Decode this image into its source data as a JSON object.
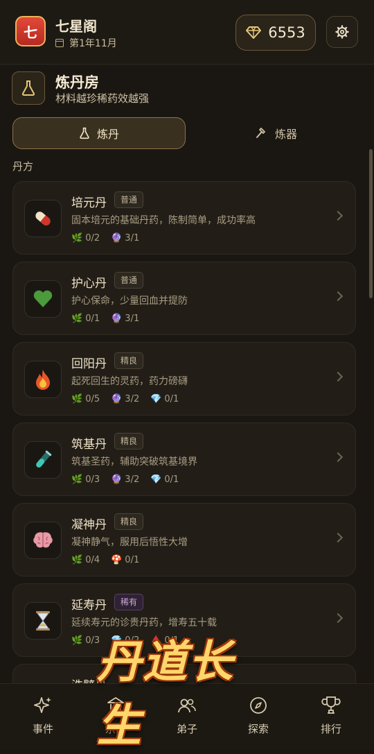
{
  "header": {
    "logo_char": "七",
    "sect_name": "七星阁",
    "date": "第1年11月",
    "gems": "6553"
  },
  "room": {
    "title": "炼丹房",
    "subtitle": "材料越珍稀药效越强"
  },
  "tabs": [
    {
      "label": "炼丹",
      "icon": "flask-icon",
      "active": true
    },
    {
      "label": "炼器",
      "icon": "hammer-icon",
      "active": false
    }
  ],
  "section_label": "丹方",
  "recipes": [
    {
      "name": "培元丹",
      "badge": "普通",
      "icon": "pill-icon",
      "desc": "固本培元的基础丹药，陈制简单，成功率高",
      "mats": [
        {
          "icon": "herb-icon",
          "text": "0/2"
        },
        {
          "icon": "orb-icon",
          "text": "3/1"
        }
      ]
    },
    {
      "name": "护心丹",
      "badge": "普通",
      "icon": "green-heart-icon",
      "desc": "护心保命，少量回血并提防",
      "mats": [
        {
          "icon": "herb-icon",
          "text": "0/1"
        },
        {
          "icon": "orb-icon",
          "text": "3/1"
        }
      ]
    },
    {
      "name": "回阳丹",
      "badge": "精良",
      "icon": "fire-icon",
      "desc": "起死回生的灵药，药力磅礴",
      "mats": [
        {
          "icon": "herb-icon",
          "text": "0/5"
        },
        {
          "icon": "orb-icon",
          "text": "3/2"
        },
        {
          "icon": "diamond-icon",
          "text": "0/1"
        }
      ]
    },
    {
      "name": "筑基丹",
      "badge": "精良",
      "icon": "test-tube-icon",
      "desc": "筑基圣药，辅助突破筑基境界",
      "mats": [
        {
          "icon": "herb-icon",
          "text": "0/3"
        },
        {
          "icon": "orb-icon",
          "text": "3/2"
        },
        {
          "icon": "diamond-icon",
          "text": "0/1"
        }
      ]
    },
    {
      "name": "凝神丹",
      "badge": "精良",
      "icon": "brain-icon",
      "desc": "凝神静气，服用后悟性大增",
      "mats": [
        {
          "icon": "herb-icon",
          "text": "0/4"
        },
        {
          "icon": "mushroom-icon",
          "text": "0/1"
        }
      ]
    },
    {
      "name": "延寿丹",
      "badge": "稀有",
      "icon": "hourglass-icon",
      "desc": "延续寿元的诊贵丹药，增寿五十载",
      "mats": [
        {
          "icon": "herb-icon",
          "text": "0/3"
        },
        {
          "icon": "diamond-icon",
          "text": "0/2"
        },
        {
          "icon": "blood-drop-icon",
          "text": "0/1"
        }
      ]
    },
    {
      "name": "洗髓丹",
      "badge": "",
      "icon": "",
      "desc": "",
      "mats": []
    }
  ],
  "nav": [
    {
      "label": "事件",
      "icon": "sparkle-icon"
    },
    {
      "label": "宗门",
      "icon": "temple-icon"
    },
    {
      "label": "弟子",
      "icon": "people-icon"
    },
    {
      "label": "探索",
      "icon": "compass-icon"
    },
    {
      "label": "排行",
      "icon": "trophy-icon"
    }
  ],
  "brand_text": "丹道长生",
  "colors": {
    "accent": "#8d7548",
    "rare": "#c9a8d6",
    "background": "#1a1712"
  }
}
